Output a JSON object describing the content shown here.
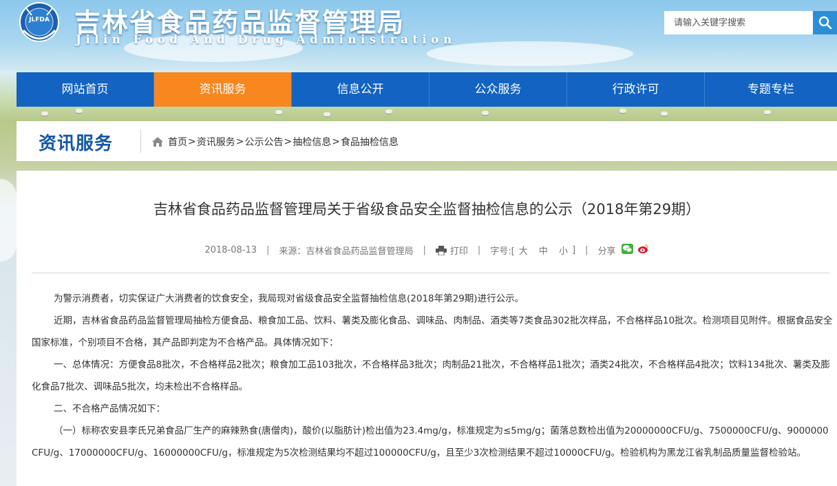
{
  "header": {
    "title": "吉林省食品药品监督管理局",
    "subtitle": "Jilin Food And Drug Administration",
    "logo_text": "JLFDA",
    "search": {
      "placeholder": "请输入关键字搜索"
    }
  },
  "nav": {
    "items": [
      {
        "label": "网站首页"
      },
      {
        "label": "资讯服务"
      },
      {
        "label": "信息公开"
      },
      {
        "label": "公众服务"
      },
      {
        "label": "行政许可"
      },
      {
        "label": "专题专栏"
      }
    ],
    "active_index": 1
  },
  "section": {
    "title": "资讯服务",
    "breadcrumb": [
      "首页",
      "资讯服务",
      "公示公告",
      "抽检信息",
      "食品抽检信息"
    ],
    "breadcrumb_sep": ">"
  },
  "article": {
    "title": "吉林省食品药品监督管理局关于省级食品安全监督抽检信息的公示（2018年第29期）",
    "date": "2018-08-13",
    "source_label": "来源：",
    "source": "吉林省食品药品监督管理局",
    "print_label": "打印",
    "fontsize_label": "字号:[",
    "fontsize_options": [
      "大",
      "中",
      "小"
    ],
    "fontsize_close": "]",
    "share_label": "分享",
    "sep": "|",
    "paragraphs": [
      "为警示消费者，切实保证广大消费者的饮食安全，我局现对省级食品安全监督抽检信息(2018年第29期)进行公示。",
      "近期，吉林省食品药品监督管理局抽检方便食品、粮食加工品、饮料、薯类及膨化食品、调味品、肉制品、酒类等7类食品302批次样品，不合格样品10批次。检测项目见附件。根据食品安全国家标准，个别项目不合格，其产品即判定为不合格产品。具体情况如下：",
      "一、总体情况：方便食品8批次，不合格样品2批次；粮食加工品103批次，不合格样品3批次；肉制品21批次，不合格样品1批次；酒类24批次，不合格样品4批次；饮料134批次、薯类及膨化食品7批次、调味品5批次，均未检出不合格样品。",
      "二、不合格产品情况如下：",
      "（一）标称农安县李氏兄弟食品厂生产的麻辣熟食(唐僧肉)，酸价(以脂肪计)检出值为23.4mg/g，标准规定为≤5mg/g；菌落总数检出值为20000000CFU/g、7500000CFU/g、9000000CFU/g、17000000CFU/g、16000000CFU/g，标准规定为5次检测结果均不超过100000CFU/g，且至少3次检测结果不超过10000CFU/g。检验机构为黑龙江省乳制品质量监督检验站。"
    ]
  },
  "colors": {
    "nav_bg": "#1263c2",
    "nav_active": "#f7871e",
    "section_title": "#1358a8",
    "search_button": "#2d8ed8"
  }
}
